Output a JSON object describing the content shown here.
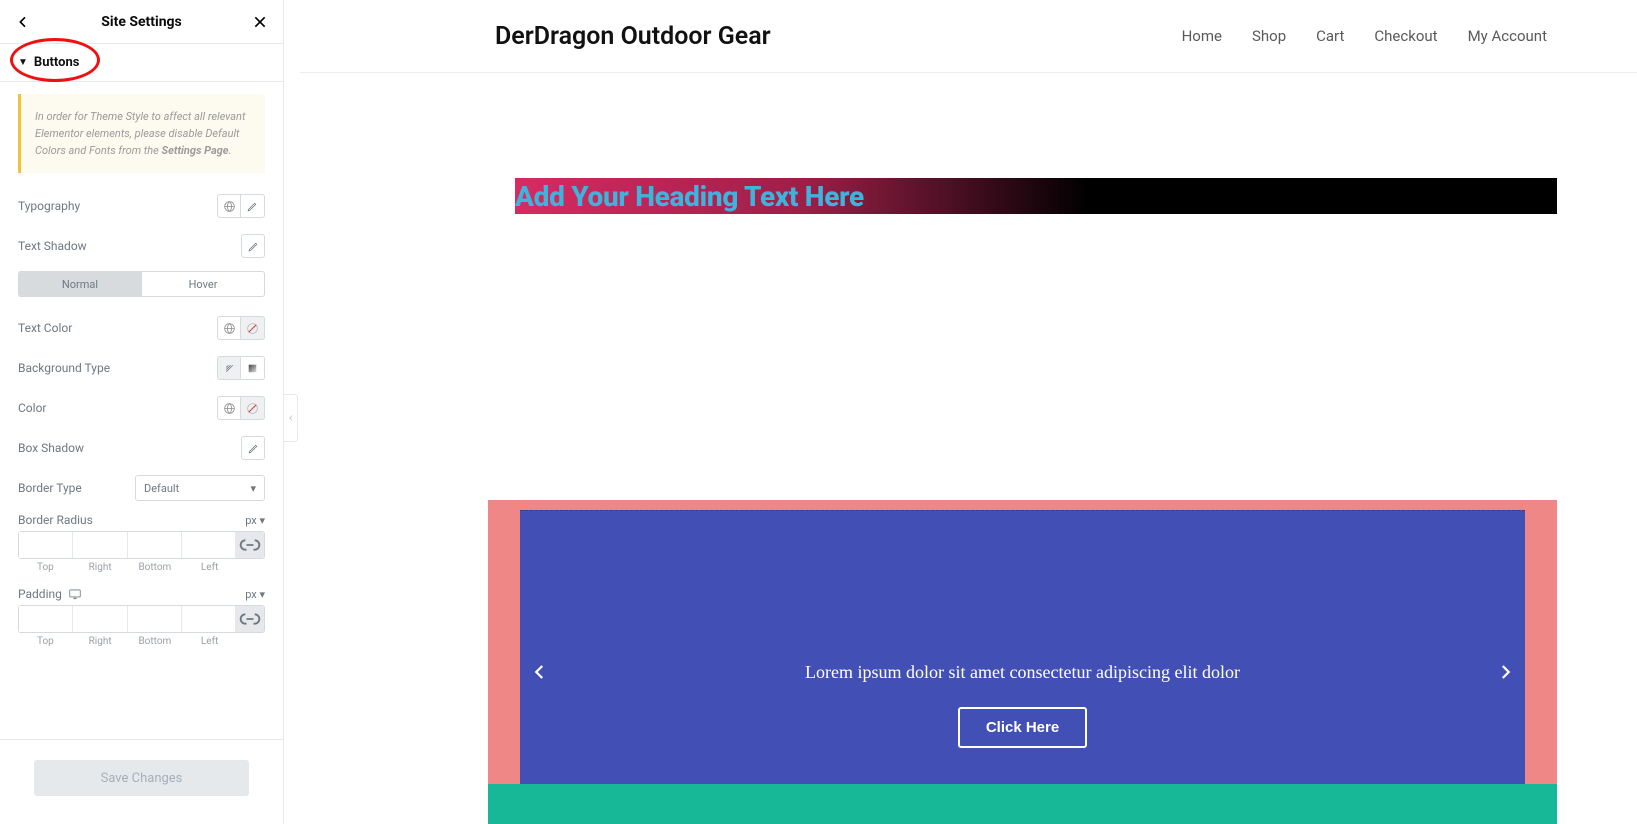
{
  "panel": {
    "title": "Site Settings",
    "section": "Buttons",
    "notice_text": "In order for Theme Style to affect all relevant Elementor elements, please disable Default Colors and Fonts from the ",
    "notice_link": "Settings Page",
    "labels": {
      "typography": "Typography",
      "text_shadow": "Text Shadow",
      "text_color": "Text Color",
      "background_type": "Background Type",
      "color": "Color",
      "box_shadow": "Box Shadow",
      "border_type": "Border Type",
      "border_radius": "Border Radius",
      "padding": "Padding"
    },
    "tabs": {
      "normal": "Normal",
      "hover": "Hover",
      "active": "normal"
    },
    "border_type_value": "Default",
    "unit": "px",
    "sides": {
      "top": "Top",
      "right": "Right",
      "bottom": "Bottom",
      "left": "Left"
    },
    "save": "Save Changes"
  },
  "site": {
    "brand": "DerDragon Outdoor Gear",
    "nav": [
      "Home",
      "Shop",
      "Cart",
      "Checkout",
      "My Account"
    ],
    "hero_heading": "Add Your Heading Text Here",
    "banner_text": "Lorem ipsum dolor sit amet consectetur adipiscing elit dolor",
    "cta": "Click Here"
  }
}
